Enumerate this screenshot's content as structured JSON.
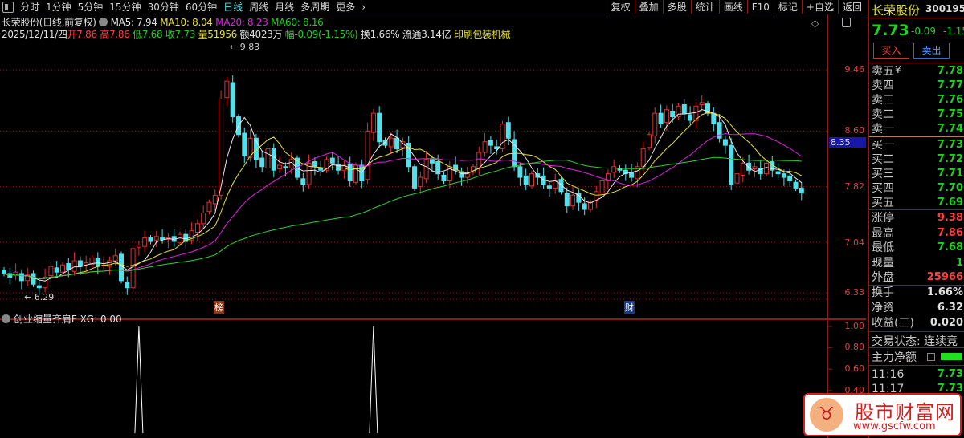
{
  "toolbar": {
    "periods": [
      "分时",
      "1分钟",
      "5分钟",
      "15分钟",
      "30分钟",
      "60分钟",
      "日线",
      "周线",
      "月线",
      "多周期",
      "更多"
    ],
    "active": "日线",
    "right_buttons": [
      "复权",
      "叠加",
      "多股",
      "统计",
      "画线",
      "F10",
      "标记",
      "+自选",
      "返回"
    ]
  },
  "legend": {
    "title": "长荣股份(日线,前复权)",
    "ma5": "MA5: 7.94",
    "ma10": "MA10: 8.04",
    "ma20": "MA20: 8.23",
    "ma60": "MA60: 8.16"
  },
  "quote_line": {
    "date": "2025/12/11/四",
    "open": "开7.86",
    "high": "高7.86",
    "low": "低7.68",
    "close": "收7.73",
    "volume": "量51956",
    "amount": "额4023万",
    "change": "幅-0.09(-1.15%)",
    "turnover": "换1.66%",
    "float": "流通3.14亿",
    "industry": "印刷包装机械"
  },
  "colors": {
    "up": "#e03030",
    "down": "#54e0ea",
    "ma5": "#e8e8e8",
    "ma10": "#e8e030",
    "ma20": "#e020e0",
    "ma60": "#30d030",
    "grid": "#8b1a1a"
  },
  "chart_data": {
    "type": "candlestick",
    "y_ticks": [
      "9.46",
      "8.60",
      "7.82",
      "7.04",
      "6.33"
    ],
    "ylim": [
      6.1,
      10.0
    ],
    "crosshair_price": "8.35",
    "max_label": "9.83",
    "min_label": "6.29",
    "closes": [
      6.6,
      6.55,
      6.62,
      6.5,
      6.58,
      6.45,
      6.4,
      6.55,
      6.7,
      6.62,
      6.72,
      6.65,
      6.78,
      6.7,
      6.75,
      6.82,
      6.7,
      6.72,
      6.78,
      6.85,
      6.5,
      6.4,
      6.95,
      7.0,
      7.1,
      7.05,
      7.12,
      7.08,
      7.1,
      7.05,
      7.15,
      7.05,
      7.2,
      7.3,
      7.45,
      7.6,
      7.7,
      9.05,
      9.3,
      8.8,
      8.55,
      8.25,
      8.5,
      8.2,
      8.1,
      8.35,
      8.05,
      8.12,
      8.08,
      8.2,
      7.95,
      7.85,
      8.15,
      8.1,
      8.05,
      8.2,
      8.15,
      8.05,
      8.12,
      7.9,
      8.12,
      7.9,
      8.6,
      8.85,
      8.45,
      8.4,
      8.5,
      8.35,
      8.45,
      8.1,
      7.8,
      7.95,
      8.2,
      8.15,
      8.0,
      7.9,
      8.1,
      8.05,
      7.95,
      8.0,
      8.1,
      8.3,
      8.45,
      8.4,
      8.35,
      8.7,
      8.5,
      8.1,
      7.95,
      7.85,
      8.0,
      7.95,
      7.85,
      7.8,
      7.9,
      7.75,
      7.55,
      7.7,
      7.6,
      7.5,
      7.6,
      7.75,
      7.9,
      8.0,
      8.1,
      8.05,
      8.0,
      7.95,
      8.1,
      8.35,
      8.55,
      8.85,
      8.7,
      8.9,
      8.8,
      8.95,
      8.85,
      8.75,
      8.95,
      9.0,
      8.85,
      8.7,
      8.5,
      8.4,
      7.85,
      8.0,
      8.15,
      8.05,
      8.1,
      8.0,
      8.15,
      8.05,
      8.0,
      7.95,
      7.9,
      7.8,
      7.73
    ],
    "markers": [
      {
        "label": "榜",
        "index": 36
      },
      {
        "label": "财",
        "index": 106
      }
    ],
    "indicator": {
      "name": "创业缩量齐肩F",
      "value_label": "XG: 0.00",
      "y_ticks": [
        "1.00",
        "0.80",
        "0.60",
        "0.40"
      ],
      "signal_indices": [
        23,
        63
      ]
    }
  },
  "panel": {
    "name": "长荣股份",
    "code": "300195",
    "price": "7.73",
    "change": "-0.09",
    "pct": "-1.15",
    "buy": "买入",
    "sell": "卖出",
    "asks": [
      {
        "label": "卖五",
        "price": "7.78"
      },
      {
        "label": "卖四",
        "price": "7.77"
      },
      {
        "label": "卖三",
        "price": "7.76"
      },
      {
        "label": "卖二",
        "price": "7.75"
      },
      {
        "label": "卖一",
        "price": "7.74"
      }
    ],
    "bids": [
      {
        "label": "买一",
        "price": "7.73"
      },
      {
        "label": "买二",
        "price": "7.72"
      },
      {
        "label": "买三",
        "price": "7.71"
      },
      {
        "label": "买四",
        "price": "7.70"
      },
      {
        "label": "买五",
        "price": "7.69"
      }
    ],
    "stats": [
      {
        "label": "涨停",
        "value": "9.38"
      },
      {
        "label": "最高",
        "value": "7.86"
      },
      {
        "label": "最低",
        "value": "7.68"
      },
      {
        "label": "现量",
        "value": "1"
      },
      {
        "label": "外盘",
        "value": "25966"
      }
    ],
    "stats2": [
      {
        "label": "换手",
        "value": "1.66%"
      },
      {
        "label": "净资",
        "value": "6.32"
      },
      {
        "label": "收益(三)",
        "value": "0.020"
      }
    ],
    "status": "交易状态: 连续竞",
    "main_flow": "主力净额",
    "ticks": [
      {
        "time": "11:16",
        "price": "7.73"
      },
      {
        "time": "11:17",
        "price": "7.73"
      }
    ]
  },
  "watermark": {
    "text": "股市财富网",
    "url": "www.gscfw.com"
  }
}
